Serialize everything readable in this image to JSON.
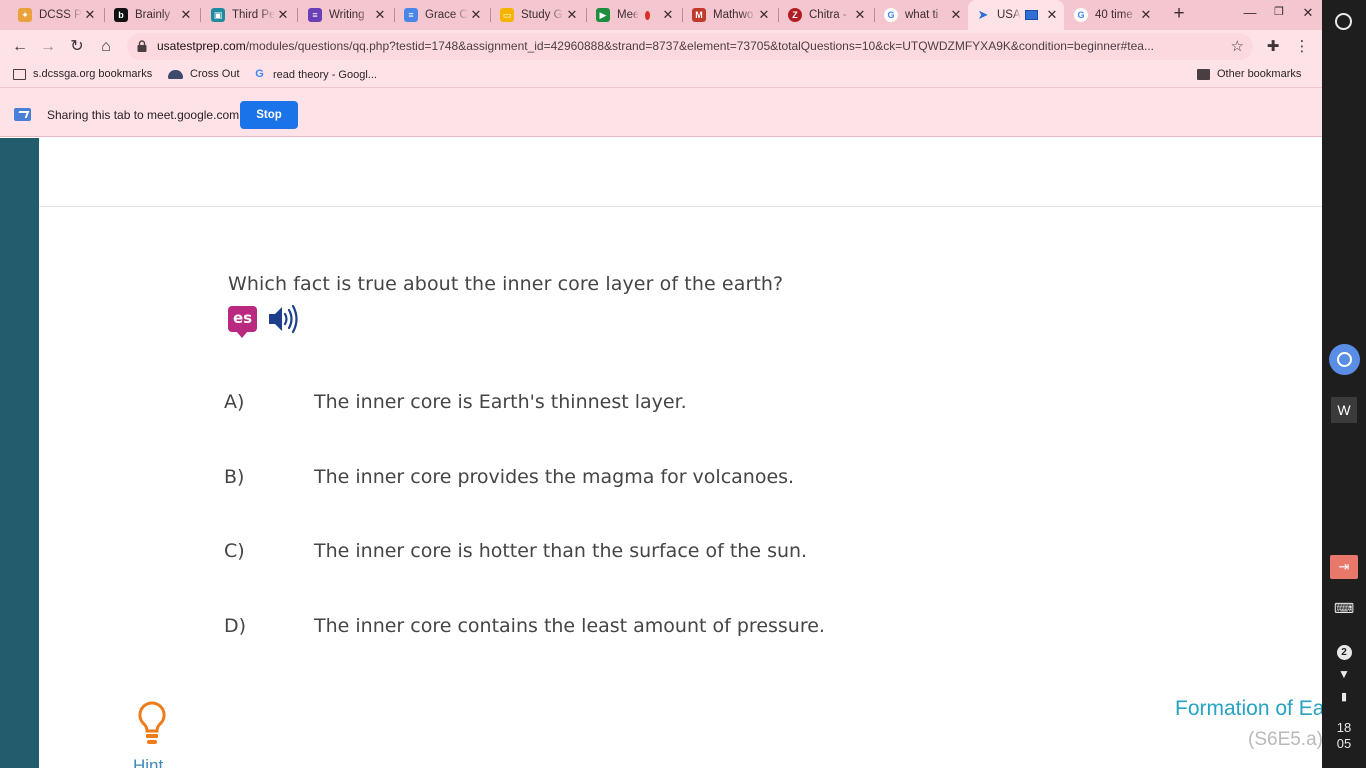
{
  "browser": {
    "tabs": [
      {
        "label": "DCSS Pa",
        "icon": "pinwheel-icon",
        "color": "#e9a13b"
      },
      {
        "label": "Brainly",
        "icon": "brainly-icon",
        "color": "#111111"
      },
      {
        "label": "Third Pe",
        "icon": "classroom-icon",
        "color": "#1f8a9e"
      },
      {
        "label": "Writing",
        "icon": "forms-icon",
        "color": "#6a3fb5"
      },
      {
        "label": "Grace C",
        "icon": "docs-icon",
        "color": "#4a86e8"
      },
      {
        "label": "Study G",
        "icon": "slides-icon",
        "color": "#f4b400"
      },
      {
        "label": "Mee",
        "icon": "meet-icon",
        "color": "#1e8e3e"
      },
      {
        "label": "Mathwo",
        "icon": "mathworks-icon",
        "color": "#c0392b"
      },
      {
        "label": "Chitra -",
        "icon": "app-icon",
        "color": "#b01e23"
      },
      {
        "label": "what ti",
        "icon": "google-icon",
        "color": "#4285f4"
      },
      {
        "label": "USA",
        "icon": "cursor-icon",
        "color": "#2f6fd6",
        "active": true
      },
      {
        "label": "40 time",
        "icon": "google-icon",
        "color": "#4285f4"
      }
    ],
    "url_domain": "usatestprep.com",
    "url_path": "/modules/questions/qq.php?testid=1748&assignment_id=42960888&strand=8737&element=73705&totalQuestions=10&ck=UTQWDZMFYXA9K&condition=beginner#tea...",
    "bookmarks": [
      {
        "label": "s.dcssga.org bookmarks"
      },
      {
        "label": "Cross Out"
      },
      {
        "label": "read theory - Googl..."
      }
    ],
    "other_bookmarks": "Other bookmarks"
  },
  "infobar": {
    "text": "Sharing this tab to meet.google.com",
    "stop_label": "Stop"
  },
  "question": {
    "text": "Which fact is true about the inner core layer of the earth?",
    "translate_icon_label": "es",
    "options": [
      {
        "letter": "A)",
        "text": "The inner core is Earth's thinnest layer."
      },
      {
        "letter": "B)",
        "text": "The inner core provides the magma for volcanoes."
      },
      {
        "letter": "C)",
        "text": "The inner core is hotter than the surface of the sun."
      },
      {
        "letter": "D)",
        "text": "The inner core contains the least amount of pressure."
      }
    ]
  },
  "footer": {
    "hint_label": "Hint",
    "standard_title": "Formation of Ea",
    "standard_code": "(S6E5.a)"
  },
  "shelf": {
    "w_app_label": "W",
    "notification_count": "2",
    "clock_hour": "18",
    "clock_minute": "05"
  },
  "colors": {
    "tab_strip": "#f4c6cf",
    "toolbar": "#fde3e8",
    "left_rail": "#235c6c",
    "standard_title": "#26a2c3",
    "stop_button": "#1a73e8"
  }
}
